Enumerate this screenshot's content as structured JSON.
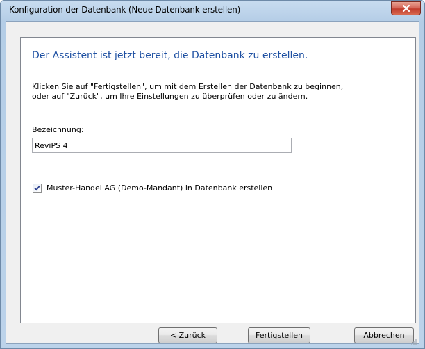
{
  "window": {
    "title": "Konfiguration der Datenbank (Neue Datenbank erstellen)",
    "close_icon": "close-icon"
  },
  "wizard": {
    "heading": "Der Assistent ist jetzt bereit, die Datenbank zu erstellen.",
    "description_line1": "Klicken Sie auf \"Fertigstellen\", um mit dem Erstellen der Datenbank zu beginnen,",
    "description_line2": "oder auf \"Zurück\", um Ihre Einstellungen zu überprüfen oder zu ändern.",
    "name_label": "Bezeichnung:",
    "name_value": "ReviPS 4",
    "demo_checkbox_label": "Muster-Handel AG (Demo-Mandant) in Datenbank erstellen",
    "demo_checkbox_checked": true
  },
  "buttons": {
    "back": "< Zurück",
    "finish": "Fertigstellen",
    "cancel": "Abbrechen"
  },
  "colors": {
    "heading": "#1e50a2",
    "close_button": "#c13c2c"
  }
}
